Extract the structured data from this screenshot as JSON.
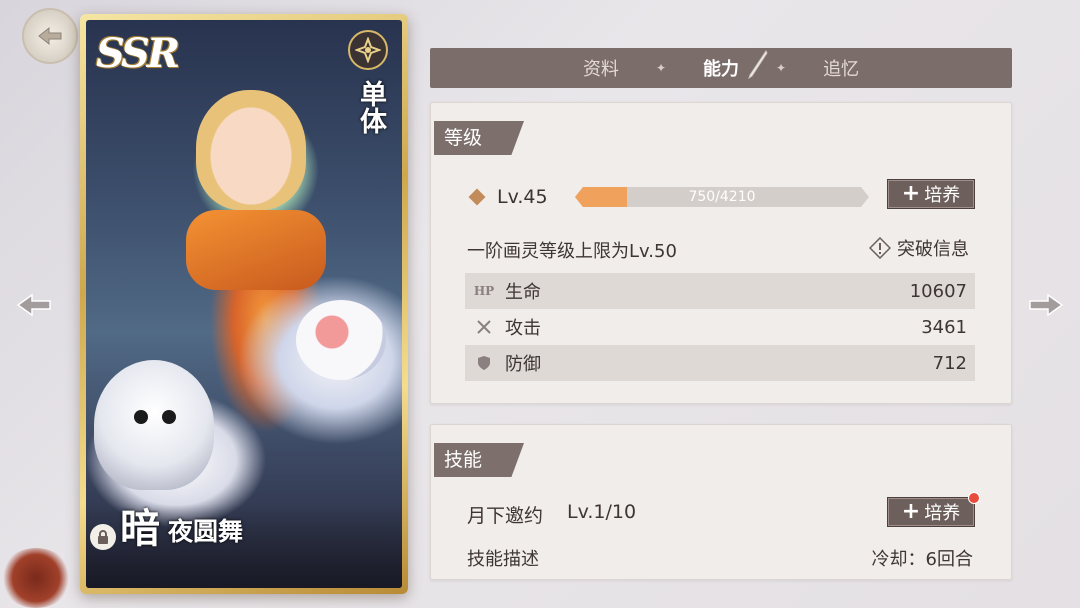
{
  "card": {
    "rarity": "SSR",
    "target_type": "单体",
    "attribute": "暗",
    "name": "夜圆舞"
  },
  "tabs": [
    {
      "label": "资料",
      "active": false
    },
    {
      "label": "能力",
      "active": true
    },
    {
      "label": "追忆",
      "active": false
    }
  ],
  "level_section": {
    "title": "等级",
    "level_label": "Lv.45",
    "xp_current": 750,
    "xp_max": 4210,
    "xp_text": "750/4210",
    "train_label": "培养",
    "limit_text": "一阶画灵等级上限为Lv.50",
    "breakthrough_label": "突破信息",
    "stats": [
      {
        "icon": "hp-icon",
        "icon_text": "HP",
        "name": "生命",
        "value": "10607"
      },
      {
        "icon": "attack-icon",
        "name": "攻击",
        "value": "3461"
      },
      {
        "icon": "defense-icon",
        "name": "防御",
        "value": "712"
      }
    ]
  },
  "skill_section": {
    "title": "技能",
    "skill_name": "月下邀约",
    "skill_level": "Lv.1/10",
    "train_label": "培养",
    "has_notification": true,
    "desc_label": "技能描述",
    "cooldown": "冷却：6回合"
  },
  "colors": {
    "accent_tab": "#7b6d6a",
    "xp_fill": "#f0a25d",
    "notification": "#e84c3d"
  }
}
